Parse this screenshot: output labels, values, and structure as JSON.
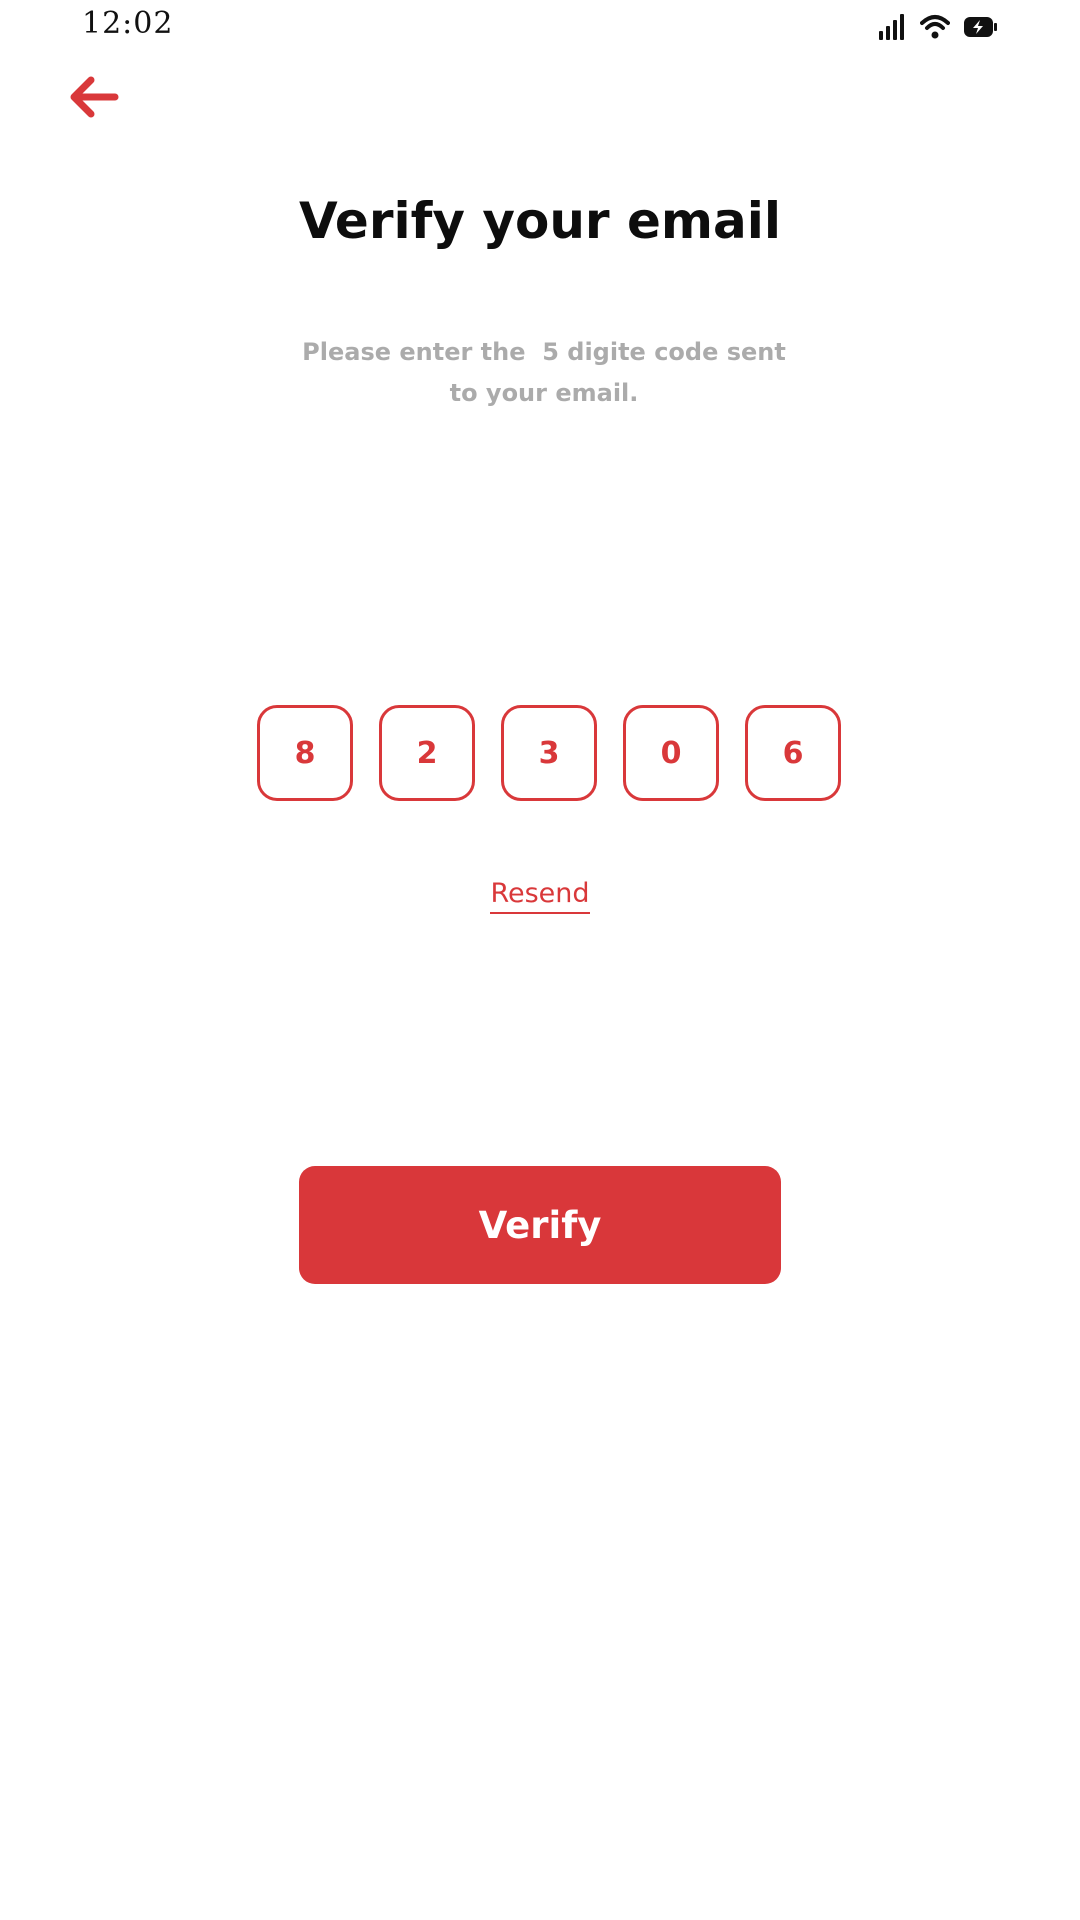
{
  "status_bar": {
    "time": "12:02",
    "icons": [
      "signal-icon",
      "wifi-icon",
      "battery-charging-icon"
    ]
  },
  "header": {
    "back_icon": "arrow-left-icon"
  },
  "main": {
    "title": "Verify your email",
    "subtitle": "Please enter the  5 digite code sent to your email.",
    "code_digits": [
      "8",
      "2",
      "3",
      "0",
      "6"
    ],
    "resend_label": "Resend",
    "verify_label": "Verify"
  },
  "colors": {
    "accent": "#d9383a",
    "subtitle_text": "#ababab",
    "title_text": "#0d0d0d",
    "background": "#ffffff"
  }
}
